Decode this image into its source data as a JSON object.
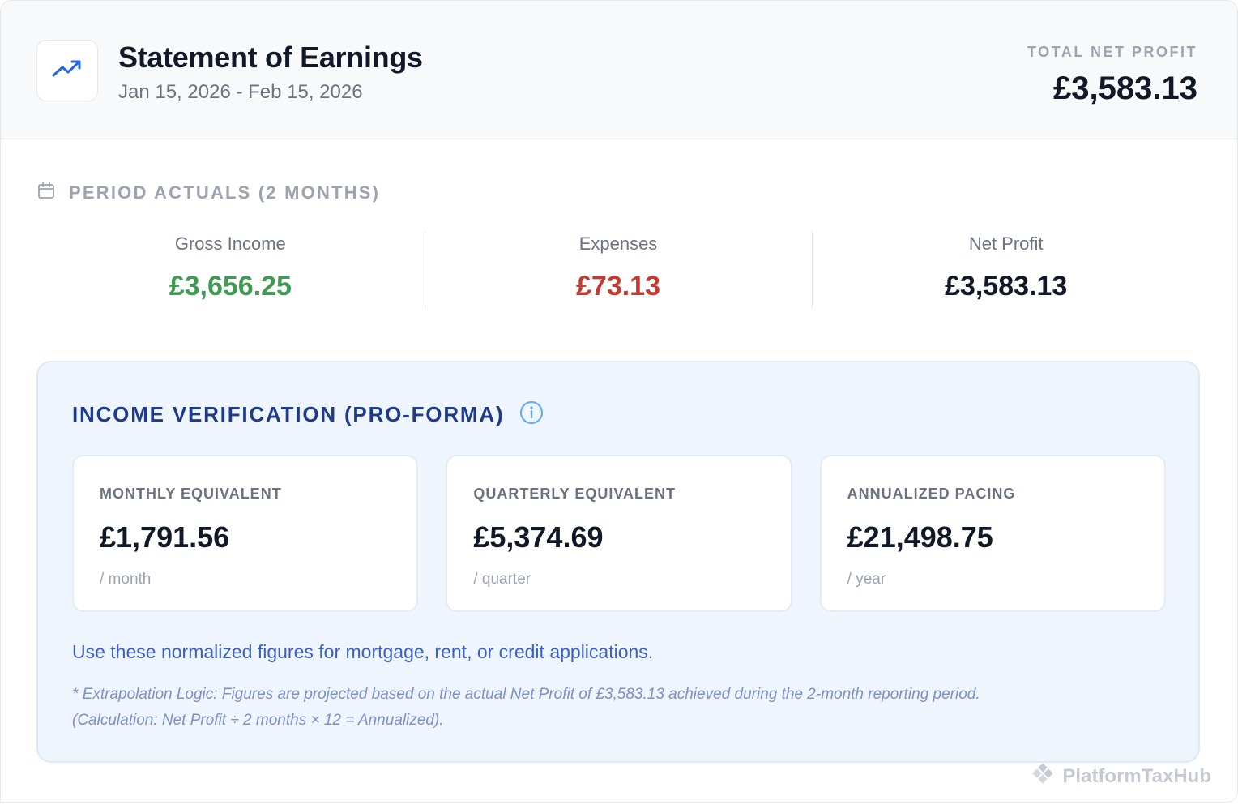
{
  "header": {
    "title": "Statement of Earnings",
    "date_range": "Jan 15, 2026 - Feb 15, 2026",
    "total_label": "TOTAL NET PROFIT",
    "total_value": "£3,583.13",
    "logo_icon": "trending-up-icon"
  },
  "period": {
    "title": "PERIOD ACTUALS (2 MONTHS)",
    "icon": "calendar-icon",
    "metrics": [
      {
        "label": "Gross Income",
        "value": "£3,656.25",
        "color": "#3f9a52"
      },
      {
        "label": "Expenses",
        "value": "£73.13",
        "color": "#c83a31"
      },
      {
        "label": "Net Profit",
        "value": "£3,583.13",
        "color": "#111827"
      }
    ]
  },
  "verification": {
    "title": "INCOME VERIFICATION (PRO-FORMA)",
    "info_icon": "info-icon",
    "tiles": [
      {
        "label": "MONTHLY EQUIVALENT",
        "value": "£1,791.56",
        "unit": "/ month"
      },
      {
        "label": "QUARTERLY EQUIVALENT",
        "value": "£5,374.69",
        "unit": "/ quarter"
      },
      {
        "label": "ANNUALIZED PACING",
        "value": "£21,498.75",
        "unit": "/ year"
      }
    ],
    "note": "Use these normalized figures for mortgage, rent, or credit applications.",
    "footnote_line1": "* Extrapolation Logic: Figures are projected based on the actual Net Profit of £3,583.13 achieved during the 2-month reporting period.",
    "footnote_line2": "(Calculation: Net Profit ÷ 2 months × 12 = Annualized)."
  },
  "brand": {
    "name": "PlatformTaxHub",
    "icon": "diamond-cluster-icon"
  },
  "colors": {
    "accent": "#2563eb",
    "panel_bg": "#eff5fd",
    "panel_title": "#1e3a8a"
  }
}
